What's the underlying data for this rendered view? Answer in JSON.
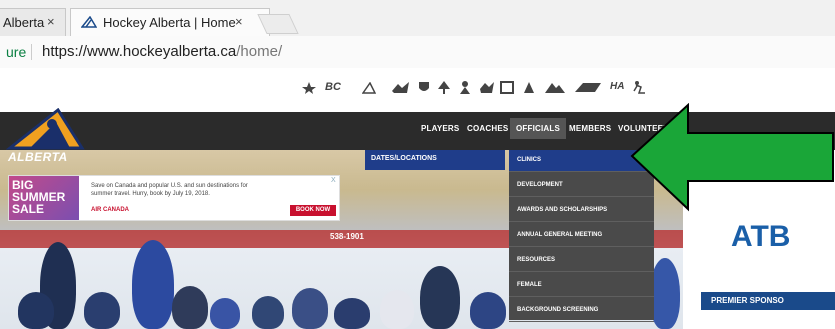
{
  "browser": {
    "tabs": [
      {
        "label": "Alberta",
        "close": "×"
      },
      {
        "label": "Hockey Alberta | Home",
        "close": "×"
      }
    ],
    "address": {
      "secure_label": "ure",
      "url_base": "https://www.hockeyalberta.ca",
      "url_path": "/home/"
    }
  },
  "site": {
    "logo_text": "ALBERTA",
    "nav": [
      "PLAYERS",
      "COACHES",
      "OFFICIALS",
      "MEMBERS",
      "VOLUNTEERS"
    ],
    "partner_logos": [
      "BC",
      "HA"
    ]
  },
  "dropdown": {
    "left_item": "DATES/LOCATIONS",
    "items": [
      "CLINICS",
      "DEVELOPMENT",
      "AWARDS AND SCHOLARSHIPS",
      "ANNUAL GENERAL MEETING",
      "RESOURCES",
      "FEMALE",
      "BACKGROUND SCREENING"
    ]
  },
  "ad": {
    "headline": [
      "BIG",
      "SUMMER",
      "SALE"
    ],
    "copy": "Save on Canada and popular U.S. and sun destinations for summer travel. Hurry, book by July 19, 2018.",
    "brand": "AIR CANADA",
    "cta": "BOOK NOW",
    "close": "X"
  },
  "rink": {
    "board_texts": [
      "538-1901"
    ]
  },
  "side_ad": {
    "brand": "ATB",
    "sponsor_label": "PREMIER SPONSO"
  },
  "colors": {
    "nav_bg": "#2b2b2b",
    "dropdown_bg": "#4a4a4a",
    "dropdown_active": "#1f3d8a",
    "arrow": "#1aa638"
  }
}
